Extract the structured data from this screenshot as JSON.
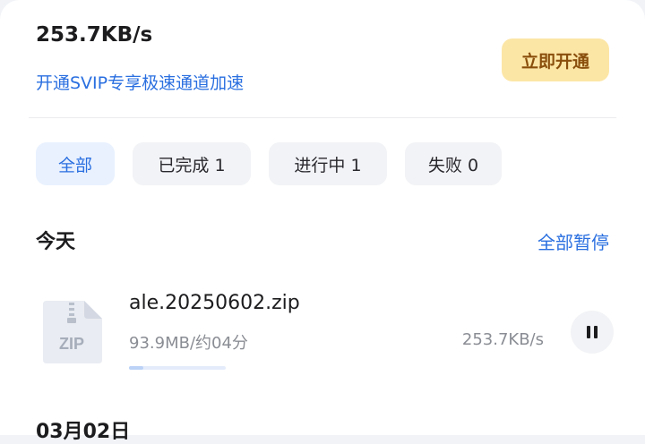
{
  "header": {
    "speed": "253.7KB/s",
    "svip_promo": "开通SVIP专享极速通道加速",
    "open_button": "立即开通"
  },
  "tabs": [
    {
      "label": "全部",
      "active": true
    },
    {
      "label": "已完成 1",
      "active": false
    },
    {
      "label": "进行中 1",
      "active": false
    },
    {
      "label": "失败 0",
      "active": false
    }
  ],
  "sections": {
    "today_label": "今天",
    "pause_all": "全部暂停",
    "next_date_label": "03月02日"
  },
  "download": {
    "file_name": "ale.20250602.zip",
    "icon_label": "ZIP",
    "size_eta": "93.9MB/约04分",
    "speed": "253.7KB/s",
    "progress_percent": 15
  },
  "colors": {
    "accent": "#2a6fe0",
    "vip_button_bg": "#fce6a6",
    "vip_button_text": "#8a4f0c"
  },
  "icons": {
    "file": "zip-file-icon",
    "pause": "pause-icon"
  }
}
